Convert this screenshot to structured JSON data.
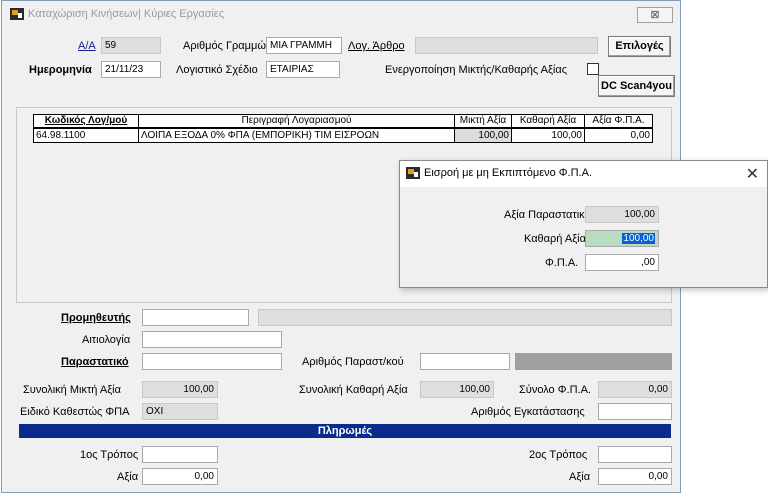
{
  "window": {
    "title": "Καταχώριση Κινήσεων| Κύριες Εργασίες",
    "close_glyph": "⊠"
  },
  "header": {
    "aa_label": "Α/Α",
    "aa_value": "59",
    "lines_label": "Αριθμός Γραμμών",
    "lines_value": "ΜΙΑ ΓΡΑΜΜΗ",
    "account_article_label": "Λογ. Άρθρο",
    "account_article_value": "",
    "options_button": "Επιλογές",
    "date_label": "Ημερομηνία",
    "date_value": "21/11/23",
    "plan_label": "Λογιστικό Σχέδιο",
    "plan_value": "ΕΤΑΙΡΙΑΣ",
    "gross_net_label": "Ενεργοποίηση Μικτής/Καθαρής Αξίας",
    "scan_button": "DC Scan4you"
  },
  "grid": {
    "headers": [
      "Κωδικός Λογ/μού",
      "Περιγραφή Λογαριασμού",
      "Μικτή Αξία",
      "Καθαρή Αξία",
      "Αξία Φ.Π.Α."
    ],
    "rows": [
      [
        "64.98.1100",
        "ΛΟΙΠΑ ΕΞΟΔΑ  0%  ΦΠΑ (ΕΜΠΟΡΙΚΗ) ΤΙΜ ΕΙΣΡΟΩΝ",
        "100,00",
        "100,00",
        "0,00"
      ]
    ]
  },
  "form": {
    "supplier_label": "Προμηθευτής",
    "supplier_value": "",
    "supplier_name": "",
    "reason_label": "Αιτιολογία",
    "reason_value": "",
    "document_label": "Παραστατικό",
    "document_value": "",
    "doc_number_label": "Αριθμός Παραστ/κού",
    "doc_number_value": "",
    "total_gross_label": "Συνολική Μικτή Αξία",
    "total_gross_value": "100,00",
    "total_net_label": "Συνολική Καθαρή Αξία",
    "total_net_value": "100,00",
    "total_vat_label": "Σύνολο Φ.Π.Α.",
    "total_vat_value": "0,00",
    "special_vat_label": "Ειδικό Καθεστώς ΦΠΑ",
    "special_vat_value": "ΟΧΙ",
    "install_label": "Αριθμός Εγκατάστασης",
    "install_value": ""
  },
  "payments": {
    "title": "Πληρωμές",
    "method1_label": "1ος Τρόπος",
    "method1_value": "",
    "value1_label": "Αξία",
    "value1": "0,00",
    "method2_label": "2ος Τρόπος",
    "method2_value": "",
    "value2_label": "Αξία",
    "value2": "0,00"
  },
  "dialog": {
    "title": "Εισροή με μη Εκπιπτόμενο Φ.Π.Α.",
    "close_glyph": "✕",
    "doc_value_label": "Αξία Παραστατικού",
    "doc_value": "100,00",
    "net_value_label": "Καθαρή Αξία",
    "net_value": "100,00",
    "vat_label": "Φ.Π.Α.",
    "vat_value": ",00"
  },
  "colors": {
    "payments_bar": "#0a2a8c",
    "selection": "#0a60d0",
    "net_field_bg": "#b8dcc0"
  }
}
